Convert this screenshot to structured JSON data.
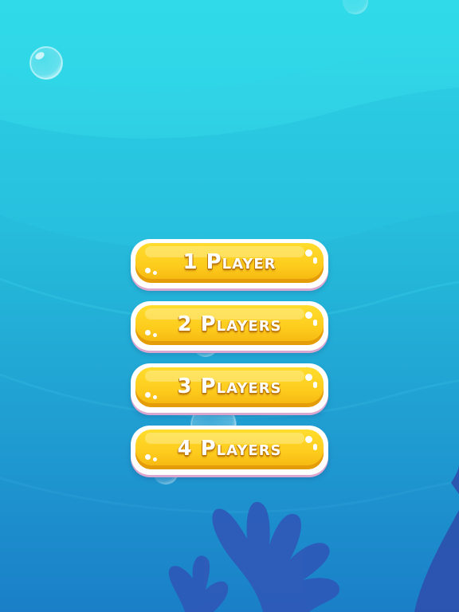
{
  "menu": {
    "buttons": [
      {
        "label": "1 Player"
      },
      {
        "label": "2 Players"
      },
      {
        "label": "3 Players"
      },
      {
        "label": "4 Players"
      }
    ]
  },
  "colors": {
    "water_top": "#2ed6e8",
    "water_bottom": "#1a7fc8",
    "button_yellow": "#fdcb1c",
    "button_shadow": "#e59c09",
    "coral": "#2f58b8"
  },
  "icons": [
    "bubble-icon",
    "coral-icon",
    "seaweed-icon"
  ]
}
